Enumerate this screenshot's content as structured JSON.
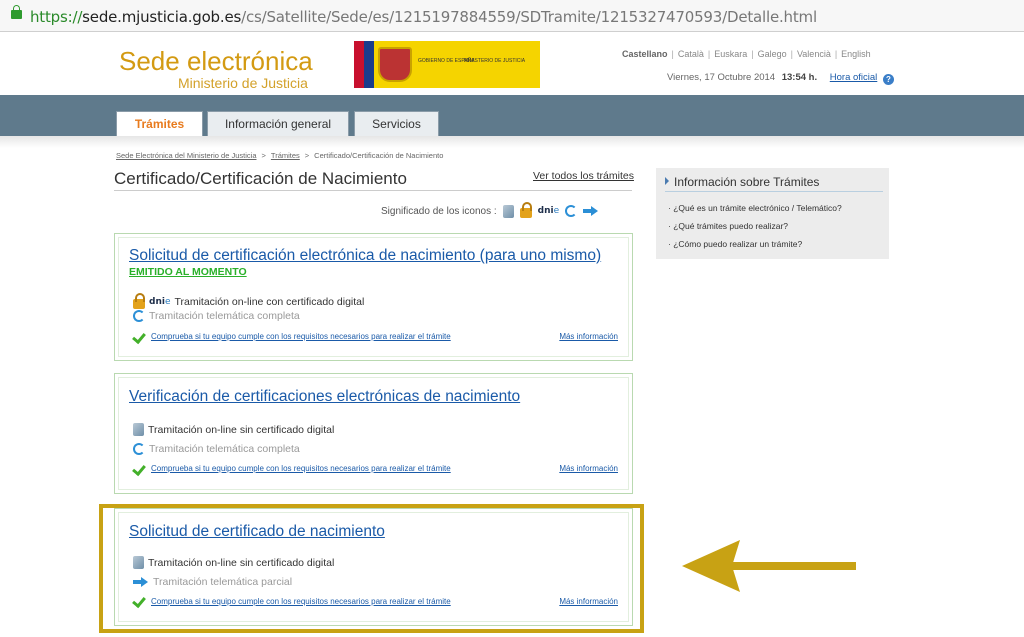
{
  "browser": {
    "url_scheme": "https://",
    "url_host": "sede.mjusticia.gob.es",
    "url_path": "/cs/Satellite/Sede/es/1215197884559/SDTramite/1215327470593/Detalle.html"
  },
  "header": {
    "title": "Sede electrónica",
    "subtitle": "Ministerio de Justicia",
    "gov_logo_text_1": "GOBIERNO DE ESPAÑA",
    "gov_logo_text_2": "MINISTERIO DE JUSTICIA",
    "languages": [
      "Castellano",
      "Català",
      "Euskara",
      "Galego",
      "Valencià",
      "English"
    ],
    "date": "Viernes, 17 Octubre 2014",
    "time": "13:54 h.",
    "official_time_link": "Hora oficial",
    "help_glyph": "?"
  },
  "nav": {
    "tabs": [
      "Trámites",
      "Información general",
      "Servicios"
    ],
    "active_tab": "Trámites"
  },
  "breadcrumb": [
    "Sede Electrónica del Ministerio de Justicia",
    "Trámites",
    "Certificado/Certificación de Nacimiento"
  ],
  "breadcrumb_sep": ">",
  "page": {
    "title": "Certificado/Certificación de Nacimiento",
    "see_all_link": "Ver todos los trámites",
    "legend_label": "Significado de los iconos :"
  },
  "cards": [
    {
      "title": "Solicitud de certificación electrónica de nacimiento (para uno mismo)",
      "subtitle": "EMITIDO AL MOMENTO",
      "row1": "Tramitación on-line con certificado digital",
      "row2": "Tramitación telemática completa",
      "check_link": "Comprueba si tu equipo cumple con los requisitos necesarios para realizar el trámite",
      "more_link": "Más información"
    },
    {
      "title": "Verificación de certificaciones electrónicas de nacimiento",
      "row1": "Tramitación on-line sin certificado digital",
      "row2": "Tramitación telemática completa",
      "check_link": "Comprueba si tu equipo cumple con los requisitos necesarios para realizar el trámite",
      "more_link": "Más información"
    },
    {
      "title": "Solicitud de certificado de nacimiento",
      "row1": "Tramitación on-line sin certificado digital",
      "row2": "Tramitación telemática parcial",
      "check_link": "Comprueba si tu equipo cumple con los requisitos necesarios para realizar el trámite",
      "more_link": "Más información"
    }
  ],
  "sidebar": {
    "title": "Información sobre Trámites",
    "links": [
      "¿Qué es un trámite electrónico / Telemático?",
      "¿Qué trámites puedo realizar?",
      "¿Cómo puedo realizar un trámite?"
    ]
  },
  "icons": {
    "dni_label": "dni",
    "dni_suffix": "e"
  },
  "colors": {
    "brand_gold": "#d39a12",
    "link_blue": "#1a5aa8",
    "nav_band": "#5f7a8c",
    "active_tab_text": "#e87b1e",
    "highlight": "#c8a214",
    "green": "#43b02a"
  }
}
